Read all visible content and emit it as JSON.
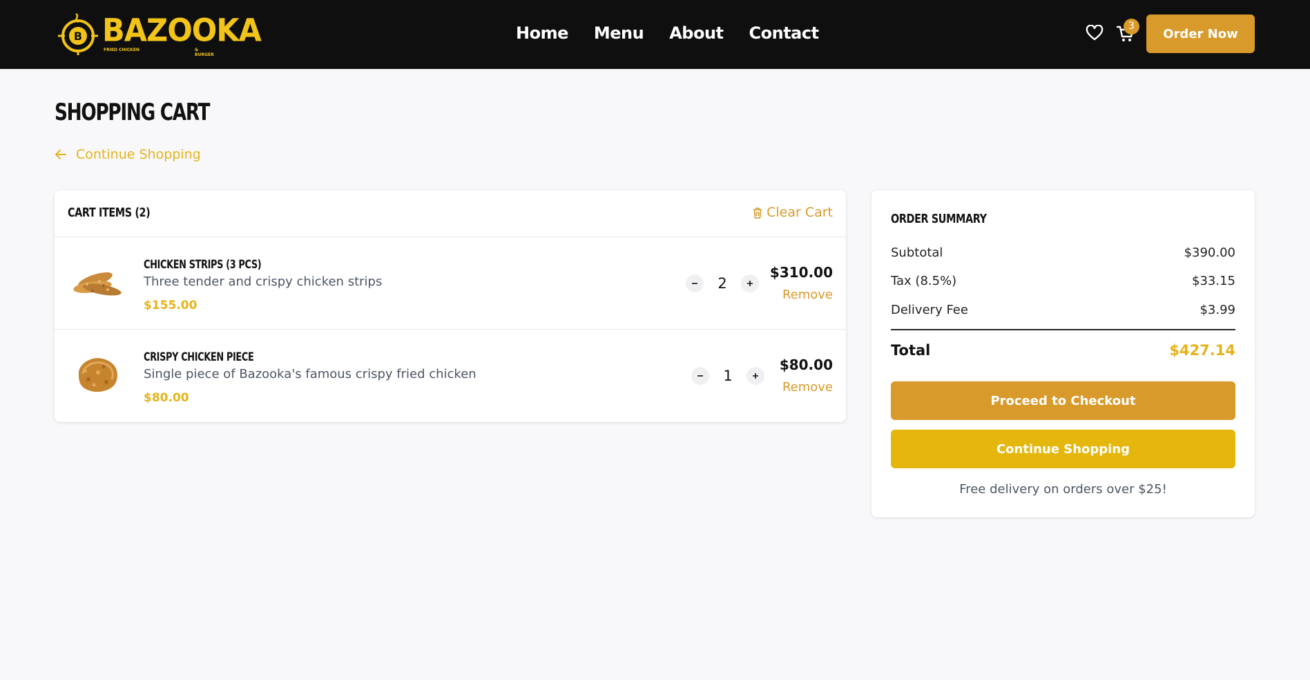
{
  "nav": {
    "brand": "BAZOOKA",
    "brand_sub_left": "FRIED CHICKEN",
    "brand_sub_right": "& BURGER",
    "links": [
      "Home",
      "Menu",
      "About",
      "Contact"
    ],
    "cart_count": "3",
    "order_now": "Order Now"
  },
  "page": {
    "title": "SHOPPING CART",
    "back_link": "Continue Shopping"
  },
  "cart": {
    "title": "CART ITEMS (2)",
    "clear_label": "Clear Cart",
    "items": [
      {
        "name": "CHICKEN STRIPS (3 PCS)",
        "description": "Three tender and crispy chicken strips",
        "price": "$155.00",
        "quantity": "2",
        "line_total": "$310.00",
        "remove_label": "Remove"
      },
      {
        "name": "CRISPY CHICKEN PIECE",
        "description": "Single piece of Bazooka's famous crispy fried chicken",
        "price": "$80.00",
        "quantity": "1",
        "line_total": "$80.00",
        "remove_label": "Remove"
      }
    ]
  },
  "summary": {
    "title": "ORDER SUMMARY",
    "subtotal_label": "Subtotal",
    "subtotal": "$390.00",
    "tax_label": "Tax (8.5%)",
    "tax": "$33.15",
    "delivery_label": "Delivery Fee",
    "delivery": "$3.99",
    "total_label": "Total",
    "total": "$427.14",
    "checkout_label": "Proceed to Checkout",
    "continue_label": "Continue Shopping",
    "free_note": "Free delivery on orders over $25!"
  },
  "colors": {
    "nav_bg": "#0f0f0f",
    "accent": "#d89a2a",
    "gold": "#e5b31a",
    "brand_yellow": "#f2c419",
    "page_bg": "#f8f8fa"
  }
}
